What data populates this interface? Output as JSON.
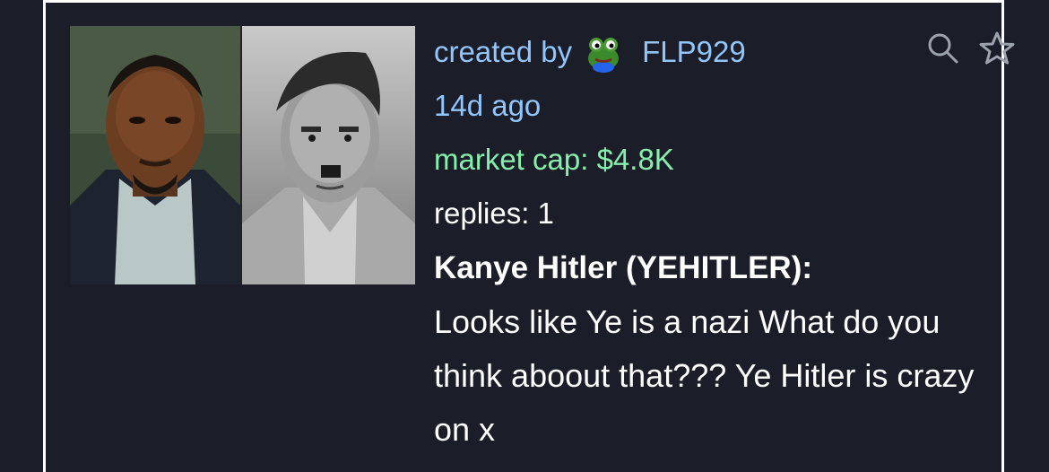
{
  "coin": {
    "creator_prefix": "created by",
    "creator_name": "FLP929",
    "age": "14d ago",
    "market_cap": "market cap: $4.8K",
    "replies": "replies: 1",
    "title": "Kanye Hitler (YEHITLER):",
    "description": "Looks like Ye is a nazi What do you think aboout that??? Ye Hitler is crazy on x"
  },
  "icons": {
    "search": "search-icon",
    "favorite": "star-icon",
    "avatar": "frog-avatar-icon"
  },
  "colors": {
    "background": "#1b1d28",
    "link": "#93c5fd",
    "market_cap": "#86efac",
    "text": "#ffffff"
  }
}
